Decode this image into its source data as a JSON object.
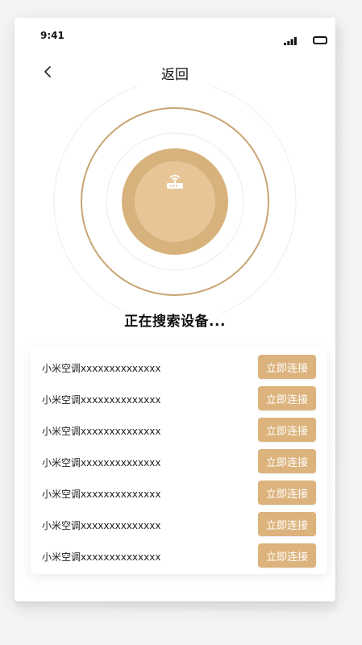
{
  "status_bar": {
    "time": "9:41",
    "signal_icon": "cellular-signal-icon",
    "battery_icon": "battery-icon"
  },
  "nav": {
    "back_icon": "chevron-left-icon",
    "title": "返回"
  },
  "radar": {
    "center_icon": "router-icon",
    "ring_color": "#c9a473",
    "outer_disc_color": "#d8b27d",
    "inner_disc_color": "#e7c597"
  },
  "search": {
    "status_text": "正在搜索设备..."
  },
  "devices": [
    {
      "name": "小米空调xxxxxxxxxxxxxx",
      "action": "立即连接"
    },
    {
      "name": "小米空调xxxxxxxxxxxxxx",
      "action": "立即连接"
    },
    {
      "name": "小米空调xxxxxxxxxxxxxx",
      "action": "立即连接"
    },
    {
      "name": "小米空调xxxxxxxxxxxxxx",
      "action": "立即连接"
    },
    {
      "name": "小米空调xxxxxxxxxxxxxx",
      "action": "立即连接"
    },
    {
      "name": "小米空调xxxxxxxxxxxxxx",
      "action": "立即连接"
    },
    {
      "name": "小米空调xxxxxxxxxxxxxx",
      "action": "立即连接"
    }
  ],
  "colors": {
    "accent": "#dcb37c",
    "button_text": "#ffffff",
    "text_primary": "#111111"
  }
}
